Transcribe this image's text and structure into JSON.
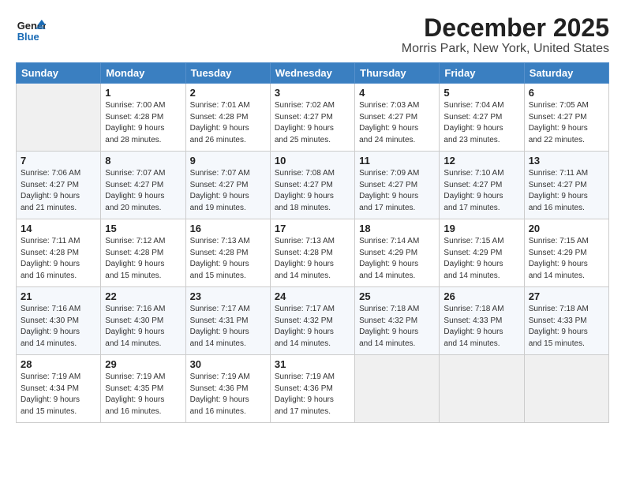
{
  "logo": {
    "line1": "General",
    "line2": "Blue"
  },
  "title": "December 2025",
  "subtitle": "Morris Park, New York, United States",
  "days_of_week": [
    "Sunday",
    "Monday",
    "Tuesday",
    "Wednesday",
    "Thursday",
    "Friday",
    "Saturday"
  ],
  "weeks": [
    [
      {
        "num": "",
        "info": ""
      },
      {
        "num": "1",
        "info": "Sunrise: 7:00 AM\nSunset: 4:28 PM\nDaylight: 9 hours\nand 28 minutes."
      },
      {
        "num": "2",
        "info": "Sunrise: 7:01 AM\nSunset: 4:28 PM\nDaylight: 9 hours\nand 26 minutes."
      },
      {
        "num": "3",
        "info": "Sunrise: 7:02 AM\nSunset: 4:27 PM\nDaylight: 9 hours\nand 25 minutes."
      },
      {
        "num": "4",
        "info": "Sunrise: 7:03 AM\nSunset: 4:27 PM\nDaylight: 9 hours\nand 24 minutes."
      },
      {
        "num": "5",
        "info": "Sunrise: 7:04 AM\nSunset: 4:27 PM\nDaylight: 9 hours\nand 23 minutes."
      },
      {
        "num": "6",
        "info": "Sunrise: 7:05 AM\nSunset: 4:27 PM\nDaylight: 9 hours\nand 22 minutes."
      }
    ],
    [
      {
        "num": "7",
        "info": "Sunrise: 7:06 AM\nSunset: 4:27 PM\nDaylight: 9 hours\nand 21 minutes."
      },
      {
        "num": "8",
        "info": "Sunrise: 7:07 AM\nSunset: 4:27 PM\nDaylight: 9 hours\nand 20 minutes."
      },
      {
        "num": "9",
        "info": "Sunrise: 7:07 AM\nSunset: 4:27 PM\nDaylight: 9 hours\nand 19 minutes."
      },
      {
        "num": "10",
        "info": "Sunrise: 7:08 AM\nSunset: 4:27 PM\nDaylight: 9 hours\nand 18 minutes."
      },
      {
        "num": "11",
        "info": "Sunrise: 7:09 AM\nSunset: 4:27 PM\nDaylight: 9 hours\nand 17 minutes."
      },
      {
        "num": "12",
        "info": "Sunrise: 7:10 AM\nSunset: 4:27 PM\nDaylight: 9 hours\nand 17 minutes."
      },
      {
        "num": "13",
        "info": "Sunrise: 7:11 AM\nSunset: 4:27 PM\nDaylight: 9 hours\nand 16 minutes."
      }
    ],
    [
      {
        "num": "14",
        "info": "Sunrise: 7:11 AM\nSunset: 4:28 PM\nDaylight: 9 hours\nand 16 minutes."
      },
      {
        "num": "15",
        "info": "Sunrise: 7:12 AM\nSunset: 4:28 PM\nDaylight: 9 hours\nand 15 minutes."
      },
      {
        "num": "16",
        "info": "Sunrise: 7:13 AM\nSunset: 4:28 PM\nDaylight: 9 hours\nand 15 minutes."
      },
      {
        "num": "17",
        "info": "Sunrise: 7:13 AM\nSunset: 4:28 PM\nDaylight: 9 hours\nand 14 minutes."
      },
      {
        "num": "18",
        "info": "Sunrise: 7:14 AM\nSunset: 4:29 PM\nDaylight: 9 hours\nand 14 minutes."
      },
      {
        "num": "19",
        "info": "Sunrise: 7:15 AM\nSunset: 4:29 PM\nDaylight: 9 hours\nand 14 minutes."
      },
      {
        "num": "20",
        "info": "Sunrise: 7:15 AM\nSunset: 4:29 PM\nDaylight: 9 hours\nand 14 minutes."
      }
    ],
    [
      {
        "num": "21",
        "info": "Sunrise: 7:16 AM\nSunset: 4:30 PM\nDaylight: 9 hours\nand 14 minutes."
      },
      {
        "num": "22",
        "info": "Sunrise: 7:16 AM\nSunset: 4:30 PM\nDaylight: 9 hours\nand 14 minutes."
      },
      {
        "num": "23",
        "info": "Sunrise: 7:17 AM\nSunset: 4:31 PM\nDaylight: 9 hours\nand 14 minutes."
      },
      {
        "num": "24",
        "info": "Sunrise: 7:17 AM\nSunset: 4:32 PM\nDaylight: 9 hours\nand 14 minutes."
      },
      {
        "num": "25",
        "info": "Sunrise: 7:18 AM\nSunset: 4:32 PM\nDaylight: 9 hours\nand 14 minutes."
      },
      {
        "num": "26",
        "info": "Sunrise: 7:18 AM\nSunset: 4:33 PM\nDaylight: 9 hours\nand 14 minutes."
      },
      {
        "num": "27",
        "info": "Sunrise: 7:18 AM\nSunset: 4:33 PM\nDaylight: 9 hours\nand 15 minutes."
      }
    ],
    [
      {
        "num": "28",
        "info": "Sunrise: 7:19 AM\nSunset: 4:34 PM\nDaylight: 9 hours\nand 15 minutes."
      },
      {
        "num": "29",
        "info": "Sunrise: 7:19 AM\nSunset: 4:35 PM\nDaylight: 9 hours\nand 16 minutes."
      },
      {
        "num": "30",
        "info": "Sunrise: 7:19 AM\nSunset: 4:36 PM\nDaylight: 9 hours\nand 16 minutes."
      },
      {
        "num": "31",
        "info": "Sunrise: 7:19 AM\nSunset: 4:36 PM\nDaylight: 9 hours\nand 17 minutes."
      },
      {
        "num": "",
        "info": ""
      },
      {
        "num": "",
        "info": ""
      },
      {
        "num": "",
        "info": ""
      }
    ]
  ]
}
